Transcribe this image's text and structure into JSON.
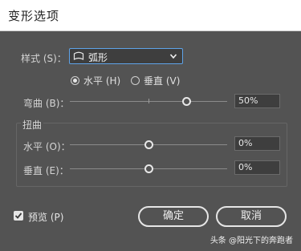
{
  "dialog": {
    "title": "变形选项"
  },
  "style": {
    "label": "样式 (S)：",
    "value": "弧形",
    "icon": "arc-shape-icon"
  },
  "orientation": {
    "horizontal": {
      "label": "水平 (H)",
      "selected": true
    },
    "vertical": {
      "label": "垂直 (V)",
      "selected": false
    }
  },
  "bend": {
    "label": "弯曲 (B)：",
    "value": "50%",
    "level": 0.75
  },
  "distortion": {
    "group_label": "扭曲",
    "horizontal": {
      "label": "水平 (O)：",
      "value": "0%",
      "level": 0.5
    },
    "vertical": {
      "label": "垂直 (E)：",
      "value": "0%",
      "level": 0.5
    }
  },
  "preview": {
    "label": "预览 (P)",
    "checked": true
  },
  "buttons": {
    "ok": "确定",
    "cancel": "取消"
  },
  "watermark": "头条 @阳光下的奔跑者",
  "colors": {
    "background": "#535353",
    "focus": "#5ea3e8",
    "field": "#3e3e3e"
  }
}
